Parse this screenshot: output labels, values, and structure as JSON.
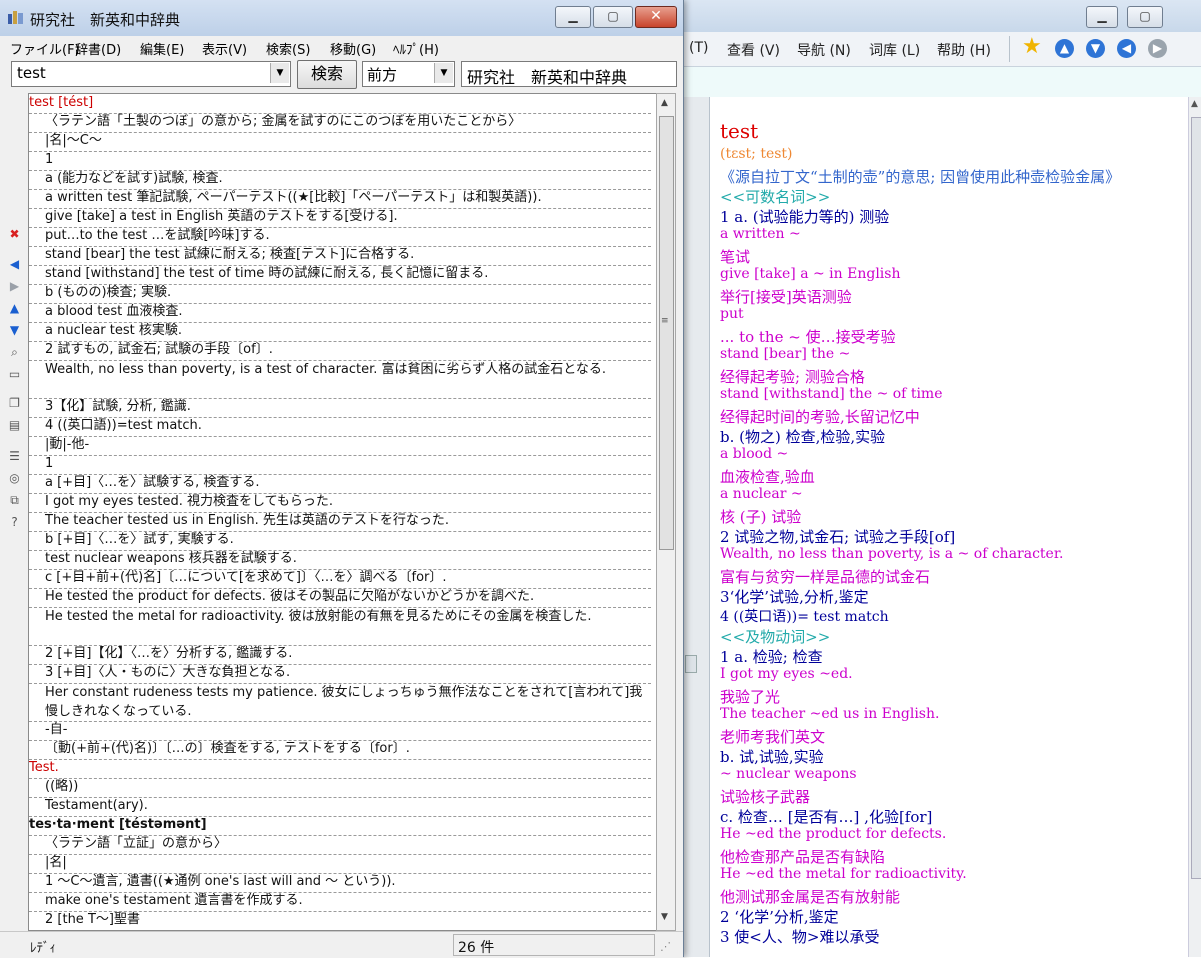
{
  "front_window": {
    "title": "研究社　新英和中辞典",
    "window_controls": {
      "minimize": "▁",
      "maximize": "▢",
      "close": "✕"
    },
    "menu": [
      "ファイル(F)",
      "辞書(D)",
      "編集(E)",
      "表示(V)",
      "検索(S)",
      "移動(G)",
      "ﾍﾙﾌﾟ(H)"
    ],
    "search": {
      "value": "test",
      "button": "検索",
      "direction": "前方",
      "dictionary": "研究社　新英和中辞典"
    },
    "side_icons": [
      "stop-icon",
      "back-arrow-icon",
      "forward-arrow-icon",
      "up-arrow-icon",
      "down-arrow-icon",
      "find-icon",
      "window-icon",
      "copy-icon",
      "clipboard-icon",
      "list-icon",
      "stamp-icon",
      "link-icon",
      "help-icon"
    ],
    "results": [
      {
        "text": "test [tést]",
        "style": "hw-red"
      },
      {
        "text": "〈ラテン語「土製のつぼ」の意から; 金属を試すのにこのつぼを用いたことから〉",
        "style": "ind"
      },
      {
        "text": "|名|～C～",
        "style": "ind"
      },
      {
        "text": "1",
        "style": "ind"
      },
      {
        "text": "a (能力などを試す)試験, 検査.",
        "style": "ind"
      },
      {
        "text": "a written test 筆記試験, ペーパーテスト((★[比較]「ペーパーテスト」は和製英語)).",
        "style": "ind"
      },
      {
        "text": "give [take] a test in English 英語のテストをする[受ける].",
        "style": "ind"
      },
      {
        "text": "put…to the test …を試験[吟味]する.",
        "style": "ind"
      },
      {
        "text": "stand [bear] the test 試練に耐える; 検査[テスト]に合格する.",
        "style": "ind"
      },
      {
        "text": "stand [withstand] the test of time 時の試練に耐える, 長く記憶に留まる.",
        "style": "ind"
      },
      {
        "text": "b (ものの)検査; 実験.",
        "style": "ind"
      },
      {
        "text": "a blood test 血液検査.",
        "style": "ind"
      },
      {
        "text": "a nuclear test 核実験.",
        "style": "ind"
      },
      {
        "text": "2 試すもの, 試金石; 試験の手段〔of〕.",
        "style": "ind"
      },
      {
        "text": "Wealth, no less than poverty, is a test of character. 富は貧困に劣らず人格の試金石となる.",
        "style": "ind wrapped"
      },
      {
        "text": "3【化】試験, 分析, 鑑識.",
        "style": "ind"
      },
      {
        "text": "4 ((英口語))=test match.",
        "style": "ind"
      },
      {
        "text": "|動|-他-",
        "style": "ind"
      },
      {
        "text": "1",
        "style": "ind"
      },
      {
        "text": "a [+目]〈…を〉試験する, 検査する.",
        "style": "ind"
      },
      {
        "text": "I got my eyes tested. 視力検査をしてもらった.",
        "style": "ind"
      },
      {
        "text": "The teacher tested us in English. 先生は英語のテストを行なった.",
        "style": "ind"
      },
      {
        "text": "b [+目]〈…を〉試す, 実験する.",
        "style": "ind"
      },
      {
        "text": "test nuclear weapons 核兵器を試験する.",
        "style": "ind"
      },
      {
        "text": "c [+目+前+(代)名]〔…について[を求めて]〕〈…を〉調べる〔for〕.",
        "style": "ind"
      },
      {
        "text": "He tested the product for defects. 彼はその製品に欠陥がないかどうかを調べた.",
        "style": "ind"
      },
      {
        "text": "He tested the metal for radioactivity. 彼は放射能の有無を見るためにその金属を検査した.",
        "style": "ind wrapped"
      },
      {
        "text": "2 [+目]【化】〈…を〉分析する, 鑑識する.",
        "style": "ind"
      },
      {
        "text": "3 [+目]〈人・ものに〉大きな負担となる.",
        "style": "ind"
      },
      {
        "text": "Her constant rudeness tests my patience. 彼女にしょっちゅう無作法なことをされて[言われて]我慢しきれなくなっている.",
        "style": "ind wrapped"
      },
      {
        "text": "-自-",
        "style": "ind"
      },
      {
        "text": "〔動(+前+(代)名)〕〔…の〕検査をする, テストをする〔for〕.",
        "style": "ind"
      },
      {
        "text": "Test.",
        "style": "hw-red"
      },
      {
        "text": "((略))",
        "style": "ind"
      },
      {
        "text": "Testament(ary).",
        "style": "ind"
      },
      {
        "text": "tes·ta·ment [téstəmənt]",
        "style": "hw"
      },
      {
        "text": "〈ラテン語「立証」の意から〉",
        "style": "ind"
      },
      {
        "text": "|名|",
        "style": "ind"
      },
      {
        "text": "1 ～C～遺言, 遺書((★通例 one's last will and ～ という)).",
        "style": "ind"
      },
      {
        "text": "make one's testament 遺言書を作成する.",
        "style": "ind"
      },
      {
        "text": "2 [the T～]聖書",
        "style": "ind"
      }
    ],
    "status": {
      "text": "ﾚﾃﾞｨ",
      "count": "26 件"
    }
  },
  "back_window": {
    "menu": [
      "(T)",
      "查看 (V)",
      "导航 (N)",
      "词库 (L)",
      "帮助 (H)"
    ],
    "toolbar_icons": [
      "star-icon",
      "up-icon",
      "down-icon",
      "back-icon",
      "forward-icon"
    ],
    "content": [
      {
        "text": "test",
        "color": "red",
        "size": 20
      },
      {
        "text": "(tɛst; test)",
        "color": "orange",
        "size": 14
      },
      {
        "text": "《源自拉丁文“土制的壶”的意思; 因曾使用此种壶检验金属》",
        "color": "blue",
        "size": 15
      },
      {
        "text": "<<可数名词>>",
        "color": "teal",
        "size": 15
      },
      {
        "text": "1 a. (试验能力等的) 测验",
        "color": "navy",
        "size": 15
      },
      {
        "text": "a written ~",
        "color": "magenta",
        "size": 14
      },
      {
        "text": "笔试",
        "color": "magenta",
        "size": 15
      },
      {
        "text": "give [take] a ~ in English",
        "color": "magenta",
        "size": 14
      },
      {
        "text": "举行[接受]英语测验",
        "color": "magenta",
        "size": 15
      },
      {
        "text": "put",
        "color": "magenta",
        "size": 14
      },
      {
        "text": "... to the ~ 使…接受考验",
        "color": "magenta",
        "size": 15
      },
      {
        "text": "stand [bear] the ~",
        "color": "magenta",
        "size": 14
      },
      {
        "text": "经得起考验; 测验合格",
        "color": "magenta",
        "size": 15
      },
      {
        "text": "stand [withstand] the ~ of time",
        "color": "magenta",
        "size": 14
      },
      {
        "text": "经得起时间的考验,长留记忆中",
        "color": "magenta",
        "size": 15
      },
      {
        "text": "b. (物之) 检查,检验,实验",
        "color": "navy",
        "size": 15
      },
      {
        "text": "a blood ~",
        "color": "magenta",
        "size": 14
      },
      {
        "text": "血液检查,验血",
        "color": "magenta",
        "size": 15
      },
      {
        "text": "a nuclear ~",
        "color": "magenta",
        "size": 14
      },
      {
        "text": "核 (子) 试验",
        "color": "magenta",
        "size": 15
      },
      {
        "text": "2 试验之物,试金石; 试验之手段[of]",
        "color": "navy",
        "size": 15
      },
      {
        "text": "Wealth, no less than poverty, is a ~ of character.",
        "color": "magenta",
        "size": 14
      },
      {
        "text": "富有与贫穷一样是品德的试金石",
        "color": "magenta",
        "size": 15
      },
      {
        "text": "3‘化学’试验,分析,鉴定",
        "color": "navy",
        "size": 15
      },
      {
        "text": "4 ((英口语))= test match",
        "color": "navy",
        "size": 14
      },
      {
        "text": "<<及物动词>>",
        "color": "teal",
        "size": 15
      },
      {
        "text": "1 a. 检验; 检查",
        "color": "navy",
        "size": 15
      },
      {
        "text": "I got my eyes ~ed.",
        "color": "magenta",
        "size": 14
      },
      {
        "text": "我验了光",
        "color": "magenta",
        "size": 15
      },
      {
        "text": "The teacher ~ed us in English.",
        "color": "magenta",
        "size": 14
      },
      {
        "text": "老师考我们英文",
        "color": "magenta",
        "size": 15
      },
      {
        "text": "b. 试,试验,实验",
        "color": "navy",
        "size": 15
      },
      {
        "text": "~ nuclear weapons",
        "color": "magenta",
        "size": 14
      },
      {
        "text": "试验核子武器",
        "color": "magenta",
        "size": 15
      },
      {
        "text": "c. 检查… [是否有…] ,化验[for]",
        "color": "navy",
        "size": 15
      },
      {
        "text": "He ~ed the product for defects.",
        "color": "magenta",
        "size": 14
      },
      {
        "text": "他检查那产品是否有缺陷",
        "color": "magenta",
        "size": 15
      },
      {
        "text": "He ~ed the metal for radioactivity.",
        "color": "magenta",
        "size": 14
      },
      {
        "text": "他测试那金属是否有放射能",
        "color": "magenta",
        "size": 15
      },
      {
        "text": "2 ‘化学’分析,鉴定",
        "color": "navy",
        "size": 15
      },
      {
        "text": "3 使<人、物>难以承受",
        "color": "navy",
        "size": 15
      }
    ]
  }
}
